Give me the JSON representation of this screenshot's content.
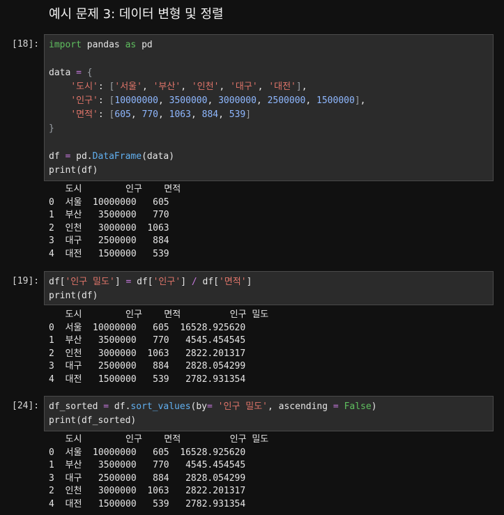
{
  "title": "예시 문제 3: 데이터 변형 및 정렬",
  "cells": [
    {
      "prompt": "[18]:",
      "lines": [
        [
          [
            "kw",
            "import"
          ],
          [
            "txt",
            " pandas "
          ],
          [
            "kw",
            "as"
          ],
          [
            "txt",
            " pd"
          ]
        ],
        [],
        [
          [
            "txt",
            "data "
          ],
          [
            "op",
            "="
          ],
          [
            "txt",
            " "
          ],
          [
            "br",
            "{"
          ]
        ],
        [
          [
            "txt",
            "    "
          ],
          [
            "str",
            "'도시'"
          ],
          [
            "txt",
            ": "
          ],
          [
            "br",
            "["
          ],
          [
            "str",
            "'서울'"
          ],
          [
            "txt",
            ", "
          ],
          [
            "str",
            "'부산'"
          ],
          [
            "txt",
            ", "
          ],
          [
            "str",
            "'인천'"
          ],
          [
            "txt",
            ", "
          ],
          [
            "str",
            "'대구'"
          ],
          [
            "txt",
            ", "
          ],
          [
            "str",
            "'대전'"
          ],
          [
            "br",
            "]"
          ],
          [
            "txt",
            ","
          ]
        ],
        [
          [
            "txt",
            "    "
          ],
          [
            "str",
            "'인구'"
          ],
          [
            "txt",
            ": "
          ],
          [
            "br",
            "["
          ],
          [
            "num",
            "10000000"
          ],
          [
            "txt",
            ", "
          ],
          [
            "num",
            "3500000"
          ],
          [
            "txt",
            ", "
          ],
          [
            "num",
            "3000000"
          ],
          [
            "txt",
            ", "
          ],
          [
            "num",
            "2500000"
          ],
          [
            "txt",
            ", "
          ],
          [
            "num",
            "1500000"
          ],
          [
            "br",
            "]"
          ],
          [
            "txt",
            ","
          ]
        ],
        [
          [
            "txt",
            "    "
          ],
          [
            "str",
            "'면적'"
          ],
          [
            "txt",
            ": "
          ],
          [
            "br",
            "["
          ],
          [
            "num",
            "605"
          ],
          [
            "txt",
            ", "
          ],
          [
            "num",
            "770"
          ],
          [
            "txt",
            ", "
          ],
          [
            "num",
            "1063"
          ],
          [
            "txt",
            ", "
          ],
          [
            "num",
            "884"
          ],
          [
            "txt",
            ", "
          ],
          [
            "num",
            "539"
          ],
          [
            "br",
            "]"
          ]
        ],
        [
          [
            "br",
            "}"
          ]
        ],
        [],
        [
          [
            "txt",
            "df "
          ],
          [
            "op",
            "="
          ],
          [
            "txt",
            " pd."
          ],
          [
            "fn",
            "DataFrame"
          ],
          [
            "txt",
            "(data)"
          ]
        ],
        [
          [
            "txt",
            "print(df)"
          ]
        ]
      ],
      "output": "   도시        인구    면적\n0  서울  10000000   605\n1  부산   3500000   770\n2  인천   3000000  1063\n3  대구   2500000   884\n4  대전   1500000   539"
    },
    {
      "prompt": "[19]:",
      "lines": [
        [
          [
            "txt",
            "df["
          ],
          [
            "str",
            "'인구 밀도'"
          ],
          [
            "txt",
            "] "
          ],
          [
            "op",
            "="
          ],
          [
            "txt",
            " df["
          ],
          [
            "str",
            "'인구'"
          ],
          [
            "txt",
            "] "
          ],
          [
            "op",
            "/"
          ],
          [
            "txt",
            " df["
          ],
          [
            "str",
            "'면적'"
          ],
          [
            "txt",
            "]"
          ]
        ],
        [
          [
            "txt",
            "print(df)"
          ]
        ]
      ],
      "output": "   도시        인구    면적         인구 밀도\n0  서울  10000000   605  16528.925620\n1  부산   3500000   770   4545.454545\n2  인천   3000000  1063   2822.201317\n3  대구   2500000   884   2828.054299\n4  대전   1500000   539   2782.931354"
    },
    {
      "prompt": "[24]:",
      "lines": [
        [
          [
            "txt",
            "df_sorted "
          ],
          [
            "op",
            "="
          ],
          [
            "txt",
            " df."
          ],
          [
            "fn",
            "sort_values"
          ],
          [
            "txt",
            "(by"
          ],
          [
            "op",
            "="
          ],
          [
            "txt",
            " "
          ],
          [
            "str",
            "'인구 밀도'"
          ],
          [
            "txt",
            ", ascending "
          ],
          [
            "op",
            "="
          ],
          [
            "txt",
            " "
          ],
          [
            "kw",
            "False"
          ],
          [
            "txt",
            ")"
          ]
        ],
        [
          [
            "txt",
            "print(df_sorted)"
          ]
        ]
      ],
      "output": "   도시        인구    면적         인구 밀도\n0  서울  10000000   605  16528.925620\n1  부산   3500000   770   4545.454545\n3  대구   2500000   884   2828.054299\n2  인천   3000000  1063   2822.201317\n4  대전   1500000   539   2782.931354"
    }
  ]
}
